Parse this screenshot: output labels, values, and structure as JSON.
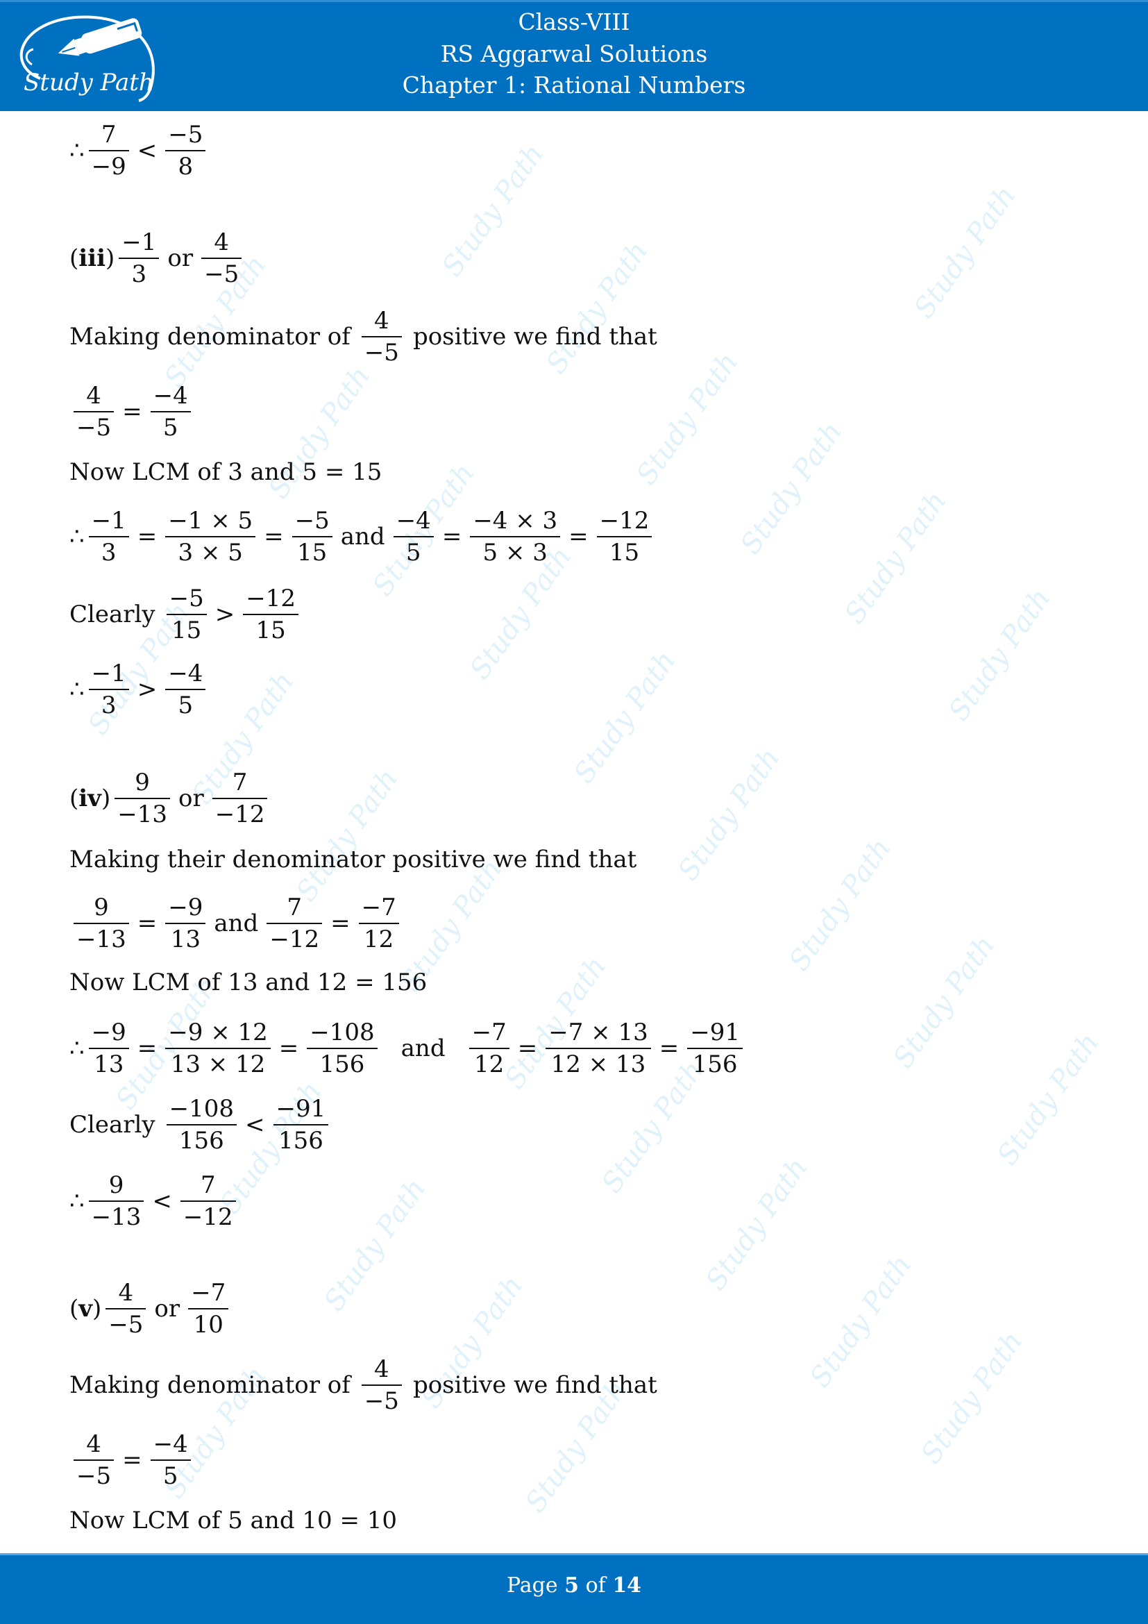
{
  "header": {
    "logo_text": "Study Path",
    "line1": "Class-VIII",
    "line2": "RS Aggarwal Solutions",
    "line3": "Chapter 1: Rational Numbers"
  },
  "colors": {
    "brand_blue": "#0070C0",
    "watermark": "#50B4E6",
    "text": "#111111"
  },
  "watermark_text": "Study Path",
  "content": {
    "l1": {
      "therefore": "∴",
      "a_num": "7",
      "a_den": "−9",
      "op": "<",
      "b_num": "−5",
      "b_den": "8"
    },
    "iii": {
      "label_open": "(",
      "label": "iii",
      "label_close": ")",
      "a_num": "−1",
      "a_den": "3",
      "or": "or",
      "b_num": "4",
      "b_den": "−5",
      "making_pre": "Making denominator of",
      "making_num": "4",
      "making_den": "−5",
      "making_post": "positive we find that",
      "eq_a_num": "4",
      "eq_a_den": "−5",
      "eq_op": "=",
      "eq_b_num": "−4",
      "eq_b_den": "5",
      "lcm": "Now LCM of 3 and 5 = 15",
      "chain": {
        "therefore": "∴",
        "f1_num": "−1",
        "f1_den": "3",
        "f2_num": "−1 × 5",
        "f2_den": "3 × 5",
        "f3_num": "−5",
        "f3_den": "15",
        "and": "and",
        "f4_num": "−4",
        "f4_den": "5",
        "f5_num": "−4 × 3",
        "f5_den": "5 × 3",
        "f6_num": "−12",
        "f6_den": "15",
        "eq": "="
      },
      "clearly": {
        "word": "Clearly",
        "a_num": "−5",
        "a_den": "15",
        "op": ">",
        "b_num": "−12",
        "b_den": "15"
      },
      "conclusion": {
        "therefore": "∴",
        "a_num": "−1",
        "a_den": "3",
        "op": ">",
        "b_num": "−4",
        "b_den": "5"
      }
    },
    "iv": {
      "label_open": "(",
      "label": "iv",
      "label_close": ")",
      "a_num": "9",
      "a_den": "−13",
      "or": "or",
      "b_num": "7",
      "b_den": "−12",
      "making": "Making their denominator positive we find that",
      "eq": {
        "f1_num": "9",
        "f1_den": "−13",
        "f2_num": "−9",
        "f2_den": "13",
        "and": "and",
        "f3_num": "7",
        "f3_den": "−12",
        "f4_num": "−7",
        "f4_den": "12",
        "op": "="
      },
      "lcm": "Now LCM of 13 and 12 = 156",
      "chain": {
        "therefore": "∴",
        "f1_num": "−9",
        "f1_den": "13",
        "f2_num": "−9 × 12",
        "f2_den": "13 × 12",
        "f3_num": "−108",
        "f3_den": "156",
        "and": "and",
        "f4_num": "−7",
        "f4_den": "12",
        "f5_num": "−7 × 13",
        "f5_den": "12 × 13",
        "f6_num": "−91",
        "f6_den": "156",
        "eq": "="
      },
      "clearly": {
        "word": "Clearly",
        "a_num": "−108",
        "a_den": "156",
        "op": "<",
        "b_num": "−91",
        "b_den": "156"
      },
      "conclusion": {
        "therefore": "∴",
        "a_num": "9",
        "a_den": "−13",
        "op": "<",
        "b_num": "7",
        "b_den": "−12"
      }
    },
    "v": {
      "label_open": "(",
      "label": "v",
      "label_close": ")",
      "a_num": "4",
      "a_den": "−5",
      "or": "or",
      "b_num": "−7",
      "b_den": "10",
      "making_pre": "Making denominator of",
      "making_num": "4",
      "making_den": "−5",
      "making_post": "positive we find that",
      "eq_a_num": "4",
      "eq_a_den": "−5",
      "eq_op": "=",
      "eq_b_num": "−4",
      "eq_b_den": "5",
      "lcm": "Now LCM of 5 and 10 = 10"
    }
  },
  "footer": {
    "page_label": "Page",
    "page_current": "5",
    "of_label": "of",
    "page_total": "14"
  }
}
